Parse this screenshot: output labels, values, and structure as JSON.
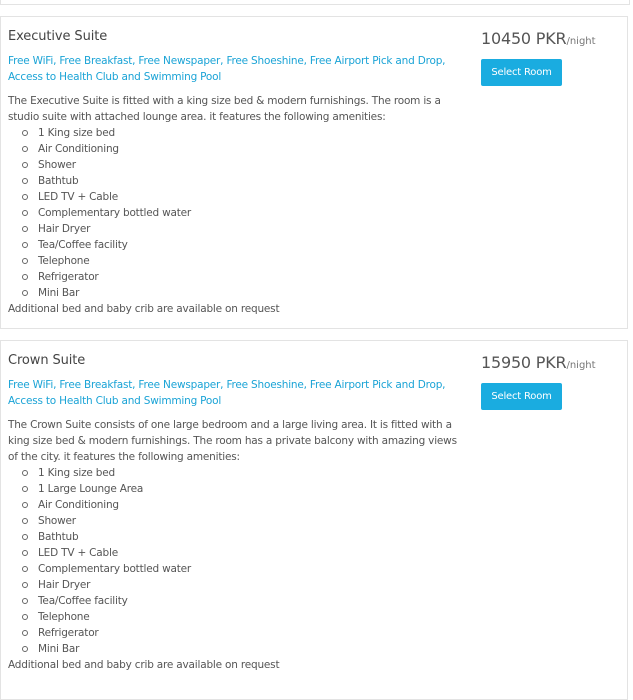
{
  "rooms": [
    {
      "name": "Executive Suite",
      "facilities": "Free WiFi, Free Breakfast, Free Newspaper, Free Shoeshine, Free Airport Pick and Drop, Access to Health Club and Swimming Pool",
      "description": "The Executive Suite is fitted with a king size bed & modern furnishings. The room is a studio suite with attached lounge area. it features the following amenities:",
      "amenities": [
        "1 King size bed",
        "Air Conditioning",
        "Shower",
        "Bathtub",
        "LED TV + Cable",
        "Complementary bottled water",
        "Hair Dryer",
        "Tea/Coffee facility",
        "Telephone",
        "Refrigerator",
        "Mini Bar"
      ],
      "note": "Additional bed and baby crib are available on request",
      "price": "10450 PKR",
      "price_unit": "/night",
      "button_label": "Select Room"
    },
    {
      "name": "Crown Suite",
      "facilities": "Free WiFi, Free Breakfast, Free Newspaper, Free Shoeshine, Free Airport Pick and Drop, Access to Health Club and Swimming Pool",
      "description": "The Crown Suite consists of one large bedroom and a large living area. It is fitted with a king size bed & modern furnishings. The room has a private balcony with amazing views of the city. it features the following amenities:",
      "amenities": [
        "1 King size bed",
        "1 Large Lounge Area",
        "Air Conditioning",
        "Shower",
        "Bathtub",
        "LED TV + Cable",
        "Complementary bottled water",
        "Hair Dryer",
        "Tea/Coffee facility",
        "Telephone",
        "Refrigerator",
        "Mini Bar"
      ],
      "note": "Additional bed and baby crib are available on request",
      "price": "15950 PKR",
      "price_unit": "/night",
      "button_label": "Select Room"
    }
  ]
}
